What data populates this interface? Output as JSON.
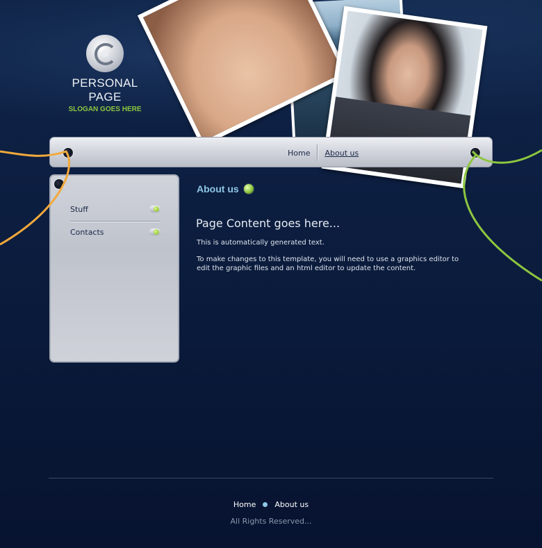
{
  "brand": {
    "title": "PERSONAL PAGE",
    "slogan": "SLOGAN GOES HERE"
  },
  "nav": {
    "items": [
      {
        "label": "Home",
        "active": false
      },
      {
        "label": "About us",
        "active": true
      }
    ]
  },
  "sidebar": {
    "items": [
      {
        "label": "Stuff"
      },
      {
        "label": "Contacts"
      }
    ]
  },
  "content": {
    "section_title": "About us",
    "heading": "Page Content goes here...",
    "paragraphs": [
      "This is automatically generated text.",
      "To make changes to this template, you will need to use a graphics editor to edit the graphic files and an html editor to update the content."
    ]
  },
  "footer": {
    "links": [
      {
        "label": "Home"
      },
      {
        "label": "About us"
      }
    ],
    "copyright": "All Rights Reserved..."
  },
  "colors": {
    "background": "#0a1a3a",
    "accent_green": "#8dc63f",
    "accent_blue": "#8fc7e6",
    "cord_orange": "#f2a93b",
    "cord_green": "#8dc63f"
  }
}
